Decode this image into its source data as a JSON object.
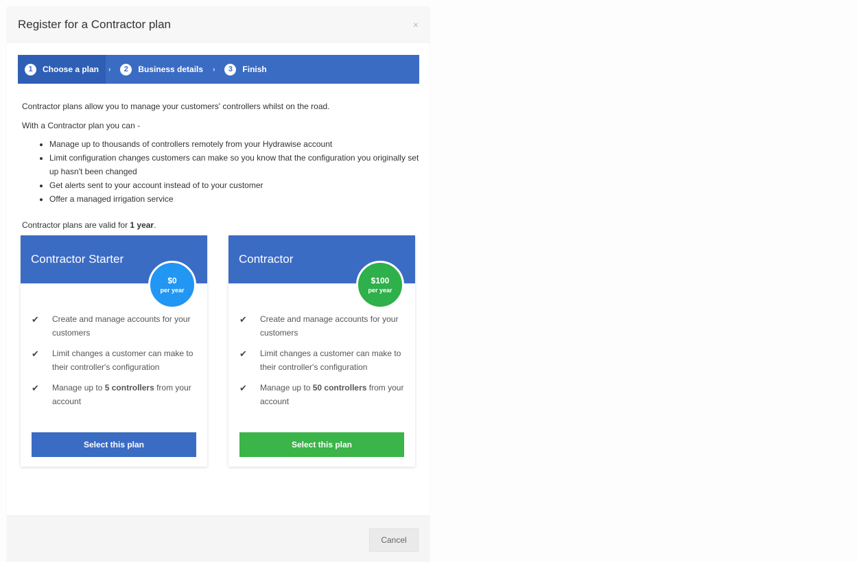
{
  "dialog": {
    "title": "Register for a Contractor plan",
    "close": "×"
  },
  "steps": [
    {
      "number": "1",
      "label": "Choose a plan"
    },
    {
      "number": "2",
      "label": "Business details"
    },
    {
      "number": "3",
      "label": "Finish"
    }
  ],
  "step_separator": "›",
  "intro": "Contractor plans allow you to manage your customers' controllers whilst on the road.",
  "with_plan": "With a Contractor plan you can -",
  "features": [
    "Manage up to thousands of controllers remotely from your Hydrawise account",
    "Limit configuration changes customers can make so you know that the configuration you originally set up hasn't been changed",
    "Get alerts sent to your account instead of to your customer",
    "Offer a managed irrigation service"
  ],
  "validity": {
    "prefix": "Contractor plans are valid for ",
    "duration": "1 year",
    "suffix": "."
  },
  "plans": [
    {
      "name": "Contractor Starter",
      "price": "$0",
      "period": "per year",
      "color": "#2196f3",
      "perk1": "Create and manage accounts for your customers",
      "perk2": "Limit changes a customer can make to their controller's configuration",
      "perk3_prefix": "Manage up to ",
      "perk3_bold": "5 controllers",
      "perk3_suffix": " from your account",
      "button": "Select this plan"
    },
    {
      "name": "Contractor",
      "price": "$100",
      "period": "per year",
      "color": "#2eb04a",
      "perk1": "Create and manage accounts for your customers",
      "perk2": "Limit changes a customer can make to their controller's configuration",
      "perk3_prefix": "Manage up to ",
      "perk3_bold": "50 controllers",
      "perk3_suffix": " from your account",
      "button": "Select this plan"
    }
  ],
  "footer": {
    "cancel": "Cancel"
  }
}
